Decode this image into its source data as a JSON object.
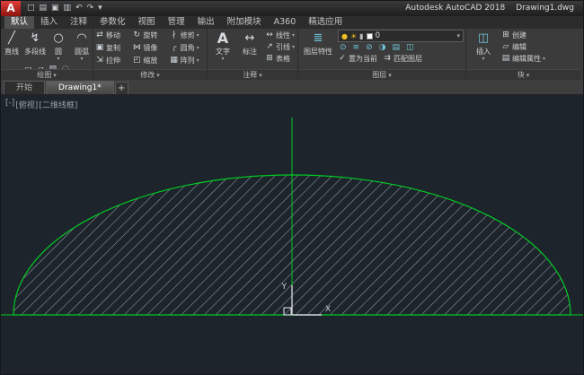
{
  "ui": {
    "caret": "▾"
  },
  "titlebar": {
    "app_letter": "A",
    "app_title": "Autodesk AutoCAD 2018",
    "doc_title": "Drawing1.dwg"
  },
  "qat": {
    "new": "□",
    "open": "▤",
    "save": "▣",
    "plot": "▥",
    "undo": "↶",
    "redo": "↷",
    "more": "▾"
  },
  "ribbon": {
    "tabs": [
      {
        "label": "默认",
        "active": true
      },
      {
        "label": "插入"
      },
      {
        "label": "注释"
      },
      {
        "label": "参数化"
      },
      {
        "label": "视图"
      },
      {
        "label": "管理"
      },
      {
        "label": "输出"
      },
      {
        "label": "附加模块"
      },
      {
        "label": "A360"
      },
      {
        "label": "精选应用"
      }
    ],
    "panels": {
      "draw": {
        "label": "绘图",
        "tools": [
          {
            "label": "直线",
            "icon": "╱"
          },
          {
            "label": "多段线",
            "icon": "↯"
          },
          {
            "label": "圆",
            "icon": "○"
          },
          {
            "label": "圆弧",
            "icon": "◠"
          }
        ],
        "extra_icons": [
          "▭",
          "▱",
          "▨",
          "◌"
        ]
      },
      "modify": {
        "label": "修改",
        "tools": [
          {
            "label": "移动",
            "icon": "⇄"
          },
          {
            "label": "旋转",
            "icon": "↻"
          },
          {
            "label": "修剪",
            "icon": "∤"
          },
          {
            "label": "复制",
            "icon": "▣"
          },
          {
            "label": "镜像",
            "icon": "⋈"
          },
          {
            "label": "圆角",
            "icon": "╭"
          },
          {
            "label": "拉伸",
            "icon": "⇲"
          },
          {
            "label": "缩放",
            "icon": "◰"
          },
          {
            "label": "阵列",
            "icon": "▦"
          }
        ]
      },
      "annotate": {
        "label": "注释",
        "text_tool": {
          "label": "文字",
          "icon": "A"
        },
        "dim_tool": {
          "label": "标注",
          "icon": "↔"
        },
        "small_tools": [
          {
            "label": "线性",
            "icon": "↔"
          },
          {
            "label": "引线",
            "icon": "↗"
          },
          {
            "label": "表格",
            "icon": "⊞"
          }
        ]
      },
      "layers": {
        "label": "图层",
        "properties_tool": {
          "label": "图层特性",
          "icon": "≣"
        },
        "dropdown": {
          "bulb": "●",
          "sun": "☀",
          "lock": "▮",
          "layer_name": "0"
        },
        "tool_icons": [
          "⊙",
          "≡",
          "⊘",
          "◑",
          "▤",
          "◫"
        ],
        "buttons": [
          {
            "label": "置为当前",
            "icon": "✓"
          },
          {
            "label": "匹配图层",
            "icon": "⇉"
          }
        ]
      },
      "block": {
        "label": "块",
        "insert_tool": {
          "label": "插入",
          "icon": "◫"
        },
        "small_tools": [
          {
            "label": "创建",
            "icon": "⊞"
          },
          {
            "label": "编辑",
            "icon": "▱"
          },
          {
            "label": "编辑属性",
            "icon": "▤"
          }
        ]
      }
    }
  },
  "file_tabs": {
    "start": "开始",
    "drawing": "Drawing1*",
    "add": "+"
  },
  "canvas": {
    "viewport_controls": [
      "[-]",
      "[俯视]",
      "[二维线框]"
    ],
    "ucs": {
      "x_label": "X",
      "y_label": "Y"
    },
    "colors": {
      "background": "#1d242c",
      "line_green": "#00cc22",
      "hatch": "#aeb6bd",
      "ucs": "#ccd1d5"
    }
  }
}
